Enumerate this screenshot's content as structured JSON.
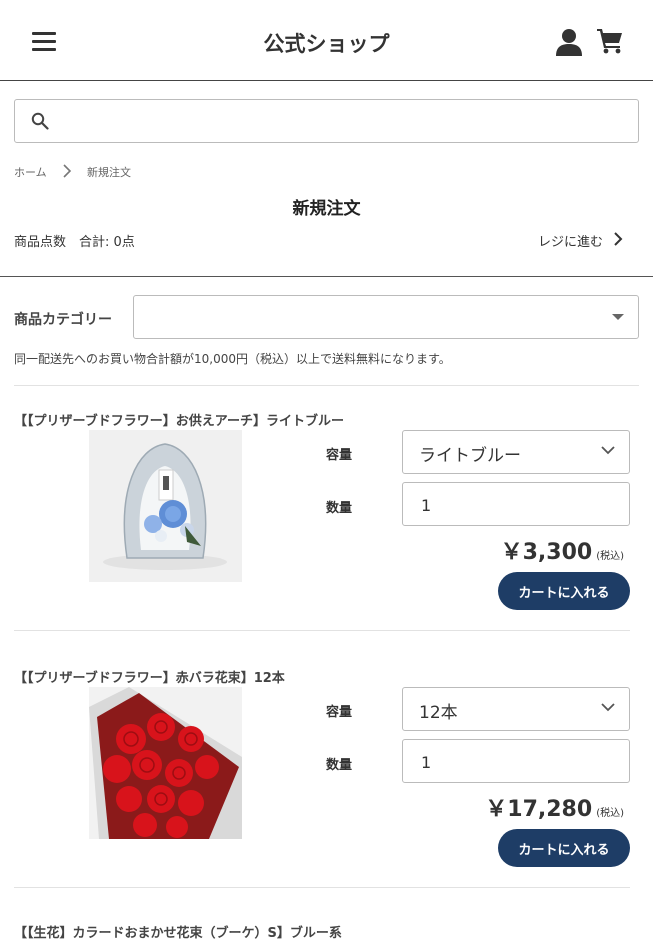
{
  "header": {
    "title": "公式ショップ"
  },
  "search": {
    "placeholder": ""
  },
  "breadcrumb": {
    "home": "ホーム",
    "current": "新規注文"
  },
  "page": {
    "title": "新規注文",
    "count_label": "商品点数",
    "count_total": "合計: 0点",
    "checkout_link": "レジに進む"
  },
  "category": {
    "label": "商品カテゴリー",
    "selected": ""
  },
  "shipping_notice": "同一配送先へのお買い物合計額が10,000円（税込）以上で送料無料になります。",
  "labels": {
    "volume": "容量",
    "quantity": "数量",
    "tax": "(税込)",
    "add_to_cart": "カートに入れる"
  },
  "products": [
    {
      "name": "【【プリザーブドフラワー】お供えアーチ】ライトブルー",
      "volume": "ライトブルー",
      "quantity": "1",
      "price": "￥3,300"
    },
    {
      "name": "【【プリザーブドフラワー】赤バラ花束】12本",
      "volume": "12本",
      "quantity": "1",
      "price": "￥17,280"
    },
    {
      "name": "【【生花】カラードおまかせ花束（ブーケ）S】ブルー系"
    }
  ],
  "colors": {
    "button": "#1e3d66",
    "text": "#333333"
  }
}
